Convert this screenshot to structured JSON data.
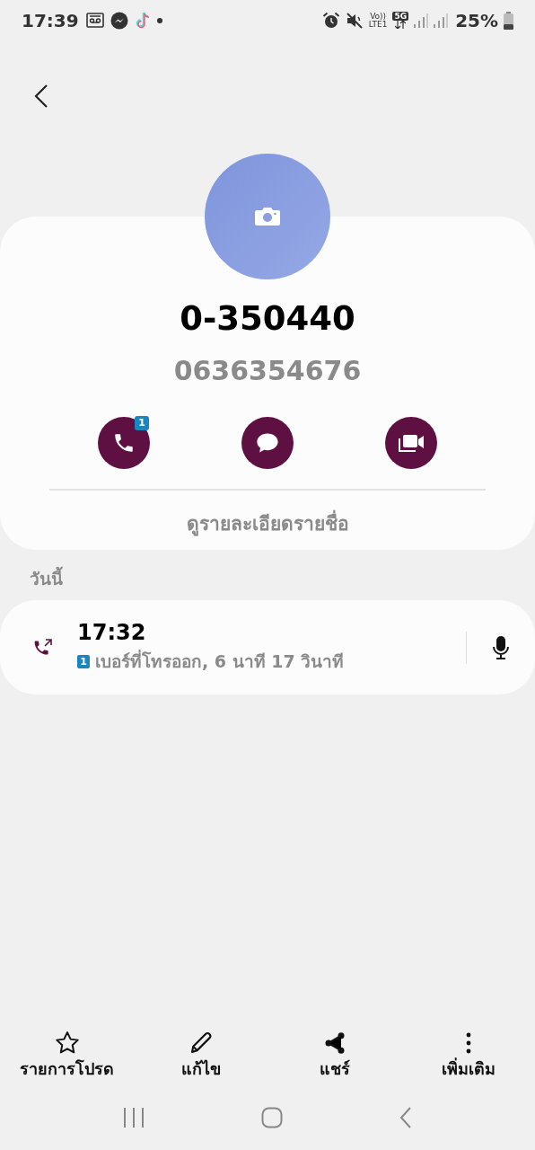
{
  "status_bar": {
    "time": "17:39",
    "volte": "Vo))",
    "lte": "LTE1",
    "network": "5G",
    "battery": "25%"
  },
  "contact": {
    "name": "0-350440",
    "number": "0636354676",
    "actions": [
      {
        "kind": "call",
        "badge": "1"
      },
      {
        "kind": "message"
      },
      {
        "kind": "video"
      }
    ],
    "details_link": "ดูรายละเอียดรายชื่อ"
  },
  "section_title": "วันนี้",
  "call_log": [
    {
      "kind": "outgoing",
      "time": "17:32",
      "sim": "1",
      "detail": "เบอร์ที่โทรออก, 6 นาที 17 วินาที"
    }
  ],
  "toolbar": [
    {
      "kind": "favorite",
      "label": "รายการโปรด"
    },
    {
      "kind": "edit",
      "label": "แก้ไข"
    },
    {
      "kind": "share",
      "label": "แชร์"
    },
    {
      "kind": "more",
      "label": "เพิ่มเติม"
    }
  ]
}
